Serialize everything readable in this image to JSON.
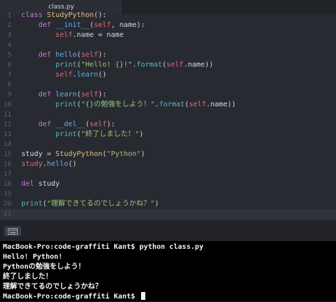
{
  "tab": {
    "label": "class.py"
  },
  "editor": {
    "lines": [
      {
        "num": "1",
        "tokens": [
          {
            "t": "class",
            "c": "kw"
          },
          {
            "t": " "
          },
          {
            "t": "StudyPython",
            "c": "cls"
          },
          {
            "t": "():"
          }
        ]
      },
      {
        "num": "2",
        "tokens": [
          {
            "t": "    "
          },
          {
            "t": "def",
            "c": "kw"
          },
          {
            "t": " "
          },
          {
            "t": "__init__",
            "c": "fn"
          },
          {
            "t": "("
          },
          {
            "t": "self",
            "c": "self"
          },
          {
            "t": ", name):"
          }
        ]
      },
      {
        "num": "3",
        "tokens": [
          {
            "t": "        "
          },
          {
            "t": "self",
            "c": "self"
          },
          {
            "t": ".name = name"
          }
        ]
      },
      {
        "num": "4",
        "tokens": []
      },
      {
        "num": "5",
        "tokens": [
          {
            "t": "    "
          },
          {
            "t": "def",
            "c": "kw"
          },
          {
            "t": " "
          },
          {
            "t": "hello",
            "c": "fn"
          },
          {
            "t": "("
          },
          {
            "t": "self",
            "c": "self"
          },
          {
            "t": "):"
          }
        ]
      },
      {
        "num": "6",
        "tokens": [
          {
            "t": "        "
          },
          {
            "t": "print",
            "c": "builtin"
          },
          {
            "t": "("
          },
          {
            "t": "\"Hello! {}!\"",
            "c": "str"
          },
          {
            "t": "."
          },
          {
            "t": "format",
            "c": "builtin"
          },
          {
            "t": "("
          },
          {
            "t": "self",
            "c": "self"
          },
          {
            "t": ".name))"
          }
        ]
      },
      {
        "num": "7",
        "tokens": [
          {
            "t": "        "
          },
          {
            "t": "self",
            "c": "self"
          },
          {
            "t": "."
          },
          {
            "t": "learn",
            "c": "fn"
          },
          {
            "t": "()"
          }
        ]
      },
      {
        "num": "8",
        "tokens": []
      },
      {
        "num": "9",
        "tokens": [
          {
            "t": "    "
          },
          {
            "t": "def",
            "c": "kw"
          },
          {
            "t": " "
          },
          {
            "t": "learn",
            "c": "fn"
          },
          {
            "t": "("
          },
          {
            "t": "self",
            "c": "self"
          },
          {
            "t": "):"
          }
        ]
      },
      {
        "num": "10",
        "tokens": [
          {
            "t": "        "
          },
          {
            "t": "print",
            "c": "builtin"
          },
          {
            "t": "("
          },
          {
            "t": "\"{}の勉強をしよう！\"",
            "c": "str"
          },
          {
            "t": "."
          },
          {
            "t": "format",
            "c": "builtin"
          },
          {
            "t": "("
          },
          {
            "t": "self",
            "c": "self"
          },
          {
            "t": ".name))"
          }
        ]
      },
      {
        "num": "11",
        "tokens": []
      },
      {
        "num": "12",
        "tokens": [
          {
            "t": "    "
          },
          {
            "t": "def",
            "c": "kw"
          },
          {
            "t": " "
          },
          {
            "t": "__del__",
            "c": "fn"
          },
          {
            "t": "("
          },
          {
            "t": "self",
            "c": "self"
          },
          {
            "t": "):"
          }
        ]
      },
      {
        "num": "13",
        "tokens": [
          {
            "t": "        "
          },
          {
            "t": "print",
            "c": "builtin"
          },
          {
            "t": "("
          },
          {
            "t": "\"終了しました！\"",
            "c": "str"
          },
          {
            "t": ")"
          }
        ]
      },
      {
        "num": "14",
        "tokens": []
      },
      {
        "num": "15",
        "tokens": [
          {
            "t": "study = "
          },
          {
            "t": "StudyPython",
            "c": "cls"
          },
          {
            "t": "("
          },
          {
            "t": "\"Python\"",
            "c": "str"
          },
          {
            "t": ")"
          }
        ]
      },
      {
        "num": "16",
        "tokens": [
          {
            "t": "study",
            "c": "self"
          },
          {
            "t": "."
          },
          {
            "t": "hello",
            "c": "fn"
          },
          {
            "t": "()"
          }
        ]
      },
      {
        "num": "17",
        "tokens": []
      },
      {
        "num": "18",
        "tokens": [
          {
            "t": "del",
            "c": "kw"
          },
          {
            "t": " study"
          }
        ]
      },
      {
        "num": "19",
        "tokens": []
      },
      {
        "num": "20",
        "tokens": [
          {
            "t": "print",
            "c": "builtin"
          },
          {
            "t": "("
          },
          {
            "t": "\"理解できてるのでしょうかね？\"",
            "c": "str"
          },
          {
            "t": ")"
          }
        ]
      },
      {
        "num": "21",
        "tokens": [],
        "active": true
      }
    ]
  },
  "footer": {
    "icon": "keyboard-icon"
  },
  "terminal": {
    "lines": [
      "MacBook-Pro:code-graffiti Kant$ python class.py",
      "Hello! Python!",
      "Pythonの勉強をしよう！",
      "終了しました！",
      "理解できてるのでしょうかね？"
    ],
    "prompt": "MacBook-Pro:code-graffiti Kant$ "
  },
  "colors": {
    "keyword": "#c678dd",
    "class": "#e5c07b",
    "function": "#61afef",
    "string": "#98c379",
    "self": "#e06c75",
    "builtin": "#56b6c2"
  }
}
